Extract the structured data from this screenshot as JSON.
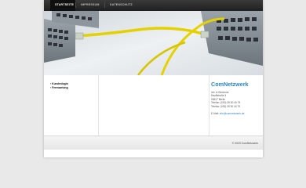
{
  "nav": {
    "items": [
      {
        "label": "STARTSEITE",
        "active": true
      },
      {
        "label": "IMPRESSUM",
        "active": false
      },
      {
        "label": "DATENSCHUTZ",
        "active": false
      }
    ]
  },
  "sidebar": {
    "items": [
      {
        "label": "Kundenlogin"
      },
      {
        "label": "Fernwartung"
      }
    ]
  },
  "contact": {
    "company": "ComNetzwerk",
    "lines": [
      "Inh. A.Gleichner",
      "Hauffstraße 4",
      "03627 Berlin",
      "Telefon: (030) 39 50 40 75",
      "Telefax: (030) 39 50 40 79"
    ],
    "email_label": "E-Mail:",
    "email": "info@comnetzwerk.de"
  },
  "footer": {
    "copyright": "© 2023 ComNetzwerk"
  },
  "colors": {
    "accent": "#2a86c7",
    "nav_bg": "#2a2a2a",
    "page_bg": "#e9e9e9",
    "cable": "#e6d100"
  }
}
